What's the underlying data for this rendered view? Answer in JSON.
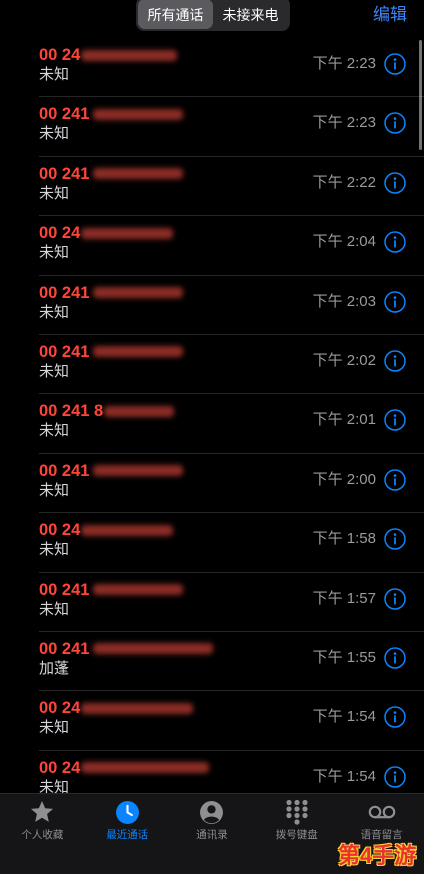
{
  "header": {
    "segments": [
      {
        "label": "所有通话",
        "selected": true
      },
      {
        "label": "未接来电",
        "selected": false
      }
    ],
    "edit_label": "编辑"
  },
  "calls": [
    {
      "number": "00 24",
      "subtitle": "未知",
      "time": "下午 2:23"
    },
    {
      "number": "00 241",
      "subtitle": "未知",
      "time": "下午 2:23"
    },
    {
      "number": "00 241",
      "subtitle": "未知",
      "time": "下午 2:22"
    },
    {
      "number": "00 24",
      "subtitle": "未知",
      "time": "下午 2:04"
    },
    {
      "number": "00 241",
      "subtitle": "未知",
      "time": "下午 2:03"
    },
    {
      "number": "00 241",
      "subtitle": "未知",
      "time": "下午 2:02"
    },
    {
      "number": "00 241 8",
      "subtitle": "未知",
      "time": "下午 2:01"
    },
    {
      "number": "00 241",
      "subtitle": "未知",
      "time": "下午 2:00"
    },
    {
      "number": "00 24",
      "subtitle": "未知",
      "time": "下午 1:58"
    },
    {
      "number": "00 241",
      "subtitle": "未知",
      "time": "下午 1:57"
    },
    {
      "number": "00 241",
      "subtitle": "加蓬",
      "time": "下午 1:55"
    },
    {
      "number": "00 24",
      "subtitle": "未知",
      "time": "下午 1:54"
    },
    {
      "number": "00 24",
      "subtitle": "未知",
      "time": "下午 1:54"
    }
  ],
  "tabbar": {
    "items": [
      {
        "label": "个人收藏",
        "icon": "star-icon",
        "selected": false
      },
      {
        "label": "最近通话",
        "icon": "clock-icon",
        "selected": true
      },
      {
        "label": "通讯录",
        "icon": "contacts-icon",
        "selected": false
      },
      {
        "label": "拨号键盘",
        "icon": "keypad-icon",
        "selected": false
      },
      {
        "label": "语音留言",
        "icon": "voicemail-icon",
        "selected": false
      }
    ]
  },
  "watermark": "第4手游",
  "colors": {
    "accent": "#0a84ff",
    "missed_call_red": "#ff453a",
    "background": "#000000"
  }
}
